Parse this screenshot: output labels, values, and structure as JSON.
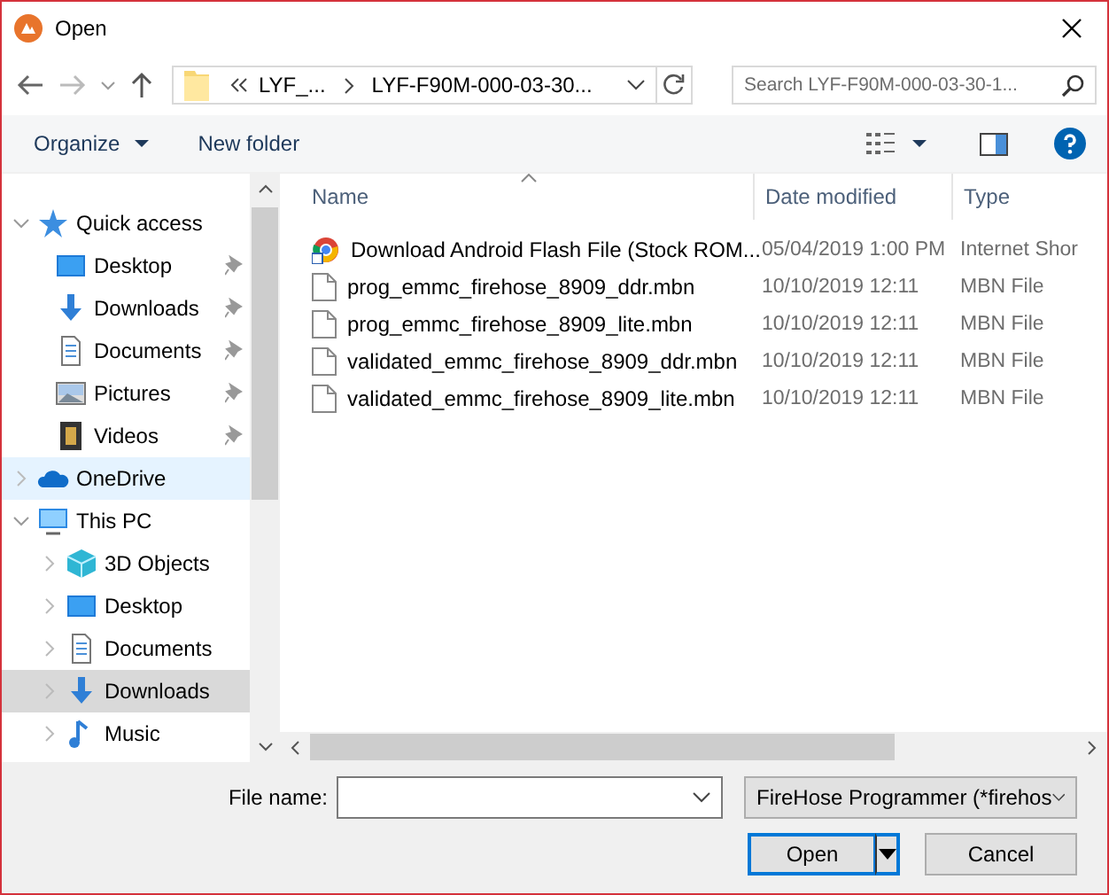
{
  "window": {
    "title": "Open"
  },
  "address_bar": {
    "crumbs": [
      "LYF_...",
      "LYF-F90M-000-03-30..."
    ]
  },
  "search": {
    "placeholder": "Search LYF-F90M-000-03-30-1..."
  },
  "toolbar": {
    "organize": "Organize",
    "new_folder": "New folder"
  },
  "sidebar": {
    "items": [
      {
        "label": "Quick access",
        "kind": "star",
        "expanded": true,
        "selected": false,
        "children": [
          {
            "label": "Desktop",
            "kind": "desktop",
            "pinned": true,
            "selected": false
          },
          {
            "label": "Downloads",
            "kind": "download",
            "pinned": true,
            "selected": false
          },
          {
            "label": "Documents",
            "kind": "document",
            "pinned": true,
            "selected": false
          },
          {
            "label": "Pictures",
            "kind": "pictures",
            "pinned": true,
            "selected": false
          },
          {
            "label": "Videos",
            "kind": "videos",
            "pinned": true,
            "selected": false
          }
        ]
      },
      {
        "label": "OneDrive",
        "kind": "cloud",
        "expanded": false,
        "selected": true
      },
      {
        "label": "This PC",
        "kind": "pc",
        "expanded": true,
        "selected": false,
        "children": [
          {
            "label": "3D Objects",
            "kind": "cube",
            "pinned": false,
            "selected": false
          },
          {
            "label": "Desktop",
            "kind": "desktop",
            "pinned": false,
            "selected": false
          },
          {
            "label": "Documents",
            "kind": "document",
            "pinned": false,
            "selected": false
          },
          {
            "label": "Downloads",
            "kind": "download",
            "pinned": false,
            "selected": true
          },
          {
            "label": "Music",
            "kind": "music",
            "pinned": false,
            "selected": false
          }
        ]
      }
    ]
  },
  "table": {
    "columns": [
      "Name",
      "Date modified",
      "Type"
    ],
    "rows": [
      {
        "kind": "shortcut",
        "name": "Download Android Flash File (Stock ROM...",
        "date": "05/04/2019 1:00 PM",
        "type": "Internet Shor"
      },
      {
        "kind": "file",
        "name": "prog_emmc_firehose_8909_ddr.mbn",
        "date": "10/10/2019 12:11",
        "type": "MBN File"
      },
      {
        "kind": "file",
        "name": "prog_emmc_firehose_8909_lite.mbn",
        "date": "10/10/2019 12:11",
        "type": "MBN File"
      },
      {
        "kind": "file",
        "name": "validated_emmc_firehose_8909_ddr.mbn",
        "date": "10/10/2019 12:11",
        "type": "MBN File"
      },
      {
        "kind": "file",
        "name": "validated_emmc_firehose_8909_lite.mbn",
        "date": "10/10/2019 12:11",
        "type": "MBN File"
      }
    ]
  },
  "file_name": {
    "label": "File name:"
  },
  "file_type": {
    "value": "FireHose Programmer (*firehos"
  },
  "buttons": [
    "Open",
    "Cancel"
  ]
}
